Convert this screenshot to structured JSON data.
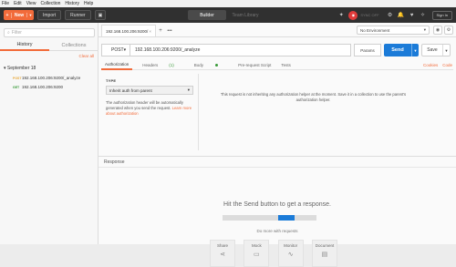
{
  "menubar": [
    "File",
    "Edit",
    "View",
    "Collection",
    "History",
    "Help"
  ],
  "header": {
    "new_label": "New",
    "import_label": "Import",
    "runner_label": "Runner",
    "builder_label": "Builder",
    "team_library_label": "Team Library",
    "sync_label": "SYNC OFF",
    "sign_in_label": "Sign In"
  },
  "sidebar": {
    "filter_placeholder": "Filter",
    "tabs": [
      "History",
      "Collections"
    ],
    "clear_all": "Clear all",
    "group": "September 18",
    "items": [
      {
        "method": "POST",
        "url": "192.168.100.206:9200/_analyze"
      },
      {
        "method": "GET",
        "url": "192.168.100.206:9200"
      }
    ]
  },
  "tab": {
    "title": "192.168.100.206:9200/"
  },
  "environment": {
    "selected": "No Environment"
  },
  "request": {
    "method": "POST",
    "url": "192.168.100.206:9200/_analyze",
    "params_label": "Params",
    "send_label": "Send",
    "save_label": "Save"
  },
  "request_tabs": {
    "authorization": "Authorization",
    "headers": "Headers",
    "headers_count": "(1)",
    "body": "Body",
    "prerequest": "Pre-request Script",
    "tests": "Tests",
    "cookies": "Cookies",
    "code": "Code"
  },
  "auth": {
    "type_label": "TYPE",
    "type_value": "Inherit auth from parent",
    "desc": "The authorization header will be automatically generated when you send the request. ",
    "learn_more": "Learn more about authorization",
    "message": "This request is not inheriting any authorization helper at the moment. Save it in a collection to use the parent's authorization helper."
  },
  "response": {
    "label": "Response",
    "hint": "Hit the Send button to get a response.",
    "progress": 0.72,
    "do_more": "Do more with requests",
    "cards": [
      "Share",
      "Mock",
      "Monitor",
      "Document"
    ]
  },
  "colors": {
    "accent": "#f26b3a",
    "send": "#1b7bd8",
    "header_bg": "#303030"
  }
}
